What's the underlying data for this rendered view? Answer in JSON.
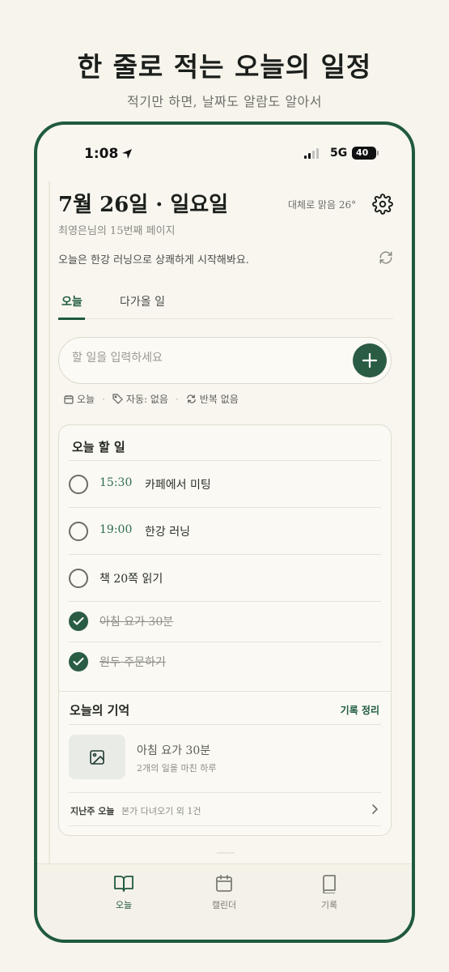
{
  "promo": {
    "headline": "한 줄로 적는 오늘의 일정",
    "subline": "적기만 하면, 날짜도 알람도 알아서"
  },
  "status_bar": {
    "time": "1:08",
    "network": "5G",
    "battery": "40"
  },
  "header": {
    "date_title": "7월 26일 · 일요일",
    "weather": "대체로 맑음 26°",
    "subtitle": "최영은님의 15번째 페이지",
    "message": "오늘은 한강 러닝으로 상쾌하게 시작해봐요."
  },
  "tabs": [
    {
      "label": "오늘",
      "active": true
    },
    {
      "label": "다가올 일",
      "active": false
    }
  ],
  "input": {
    "placeholder": "할 일을 입력하세요",
    "meta": {
      "date": "오늘",
      "tag": "자동: 없음",
      "repeat": "반복 없음"
    }
  },
  "today_card": {
    "title": "오늘 할 일",
    "tasks": [
      {
        "time": "15:30",
        "text": "카페에서 미팅",
        "done": false
      },
      {
        "time": "19:00",
        "text": "한강 러닝",
        "done": false
      },
      {
        "time": "",
        "text": "책 20쪽 읽기",
        "done": false
      },
      {
        "time": "",
        "text": "아침 요가 30분",
        "done": true
      },
      {
        "time": "",
        "text": "원두 주문하기",
        "done": true
      }
    ]
  },
  "memory": {
    "title": "오늘의 기억",
    "link": "기록 정리",
    "entry_title": "아침 요가 30분",
    "entry_desc": "2개의 일을 마친 하루",
    "lastweek_label": "지난주 오늘",
    "lastweek_text": "본가 다녀오기 외 1건"
  },
  "bottom_nav": [
    {
      "label": "오늘",
      "icon": "book-open-icon",
      "active": true
    },
    {
      "label": "캘린더",
      "icon": "calendar-icon",
      "active": false
    },
    {
      "label": "기록",
      "icon": "book-icon",
      "active": false
    }
  ],
  "colors": {
    "accent": "#1f5a3d",
    "background": "#f7f4ec"
  }
}
